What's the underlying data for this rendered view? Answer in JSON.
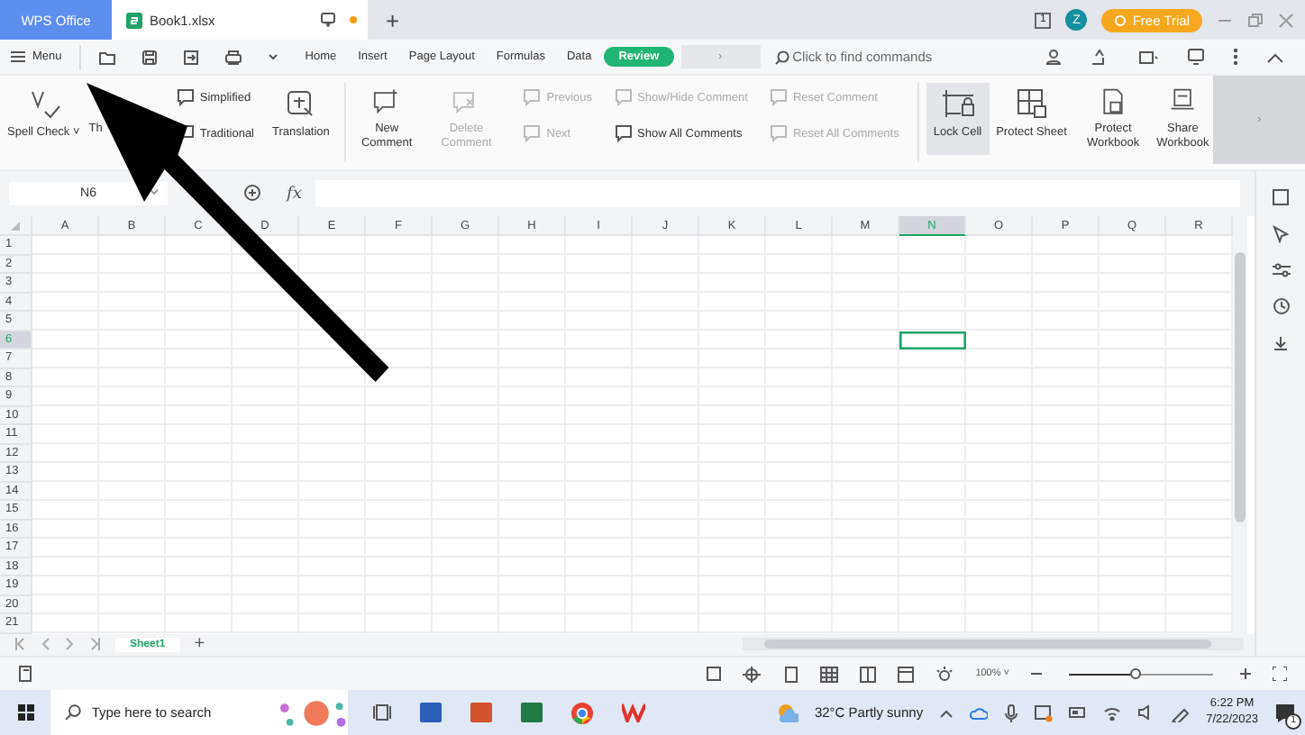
{
  "title_bar": {
    "tabs": [
      {
        "label": "WPS Office",
        "selected": false,
        "kind": "home"
      },
      {
        "label": "Book1.xlsx",
        "selected": true,
        "kind": "document"
      }
    ],
    "new_tab": "+",
    "badge_count": "1",
    "avatar": "Z",
    "trial_button": "Free Trial"
  },
  "menu_bar": {
    "menu": "Menu",
    "tabs": [
      {
        "label": "Home",
        "selected": false
      },
      {
        "label": "Insert",
        "selected": false
      },
      {
        "label": "Page Layout",
        "selected": false
      },
      {
        "label": "Formulas",
        "selected": false
      },
      {
        "label": "Data",
        "selected": false
      },
      {
        "label": "Review",
        "selected": true
      }
    ],
    "more": "›",
    "search": {
      "placeholder": "Click to find commands"
    }
  },
  "ribbon": {
    "items": [
      {
        "kind": "large",
        "label": "Spell Check ˅",
        "disabled": false,
        "on": false
      },
      {
        "kind": "cut",
        "label": "Th"
      },
      {
        "kind": "pair",
        "items": [
          {
            "label": "Simplified",
            "disabled": false
          },
          {
            "label": "Traditional",
            "disabled": false
          }
        ]
      },
      {
        "kind": "large",
        "label": "Translation",
        "disabled": false,
        "on": false
      },
      {
        "kind": "separator"
      },
      {
        "kind": "large",
        "label": "New Comment",
        "disabled": false,
        "on": false
      },
      {
        "kind": "large",
        "label": "Delete Comment",
        "disabled": true,
        "on": false
      },
      {
        "kind": "pair",
        "items": [
          {
            "label": "Previous",
            "disabled": true
          },
          {
            "label": "Next",
            "disabled": true
          }
        ]
      },
      {
        "kind": "pair",
        "items": [
          {
            "label": "Show/Hide Comment",
            "disabled": true
          },
          {
            "label": "Show All Comments",
            "disabled": false
          }
        ]
      },
      {
        "kind": "pair",
        "items": [
          {
            "label": "Reset Comment",
            "disabled": true
          },
          {
            "label": "Reset All Comments",
            "disabled": true
          }
        ]
      },
      {
        "kind": "separator"
      },
      {
        "kind": "large",
        "label": "Lock Cell",
        "disabled": false,
        "on": true
      },
      {
        "kind": "large",
        "label": "Protect Sheet",
        "disabled": false,
        "on": false
      },
      {
        "kind": "large",
        "label": "Protect Workbook",
        "disabled": false,
        "on": false
      },
      {
        "kind": "large",
        "label": "Share Workbook",
        "disabled": false,
        "on": false
      }
    ],
    "more": "›"
  },
  "formula_bar": {
    "name_box": "N6",
    "fx": "fx"
  },
  "sheet": {
    "columns": [
      {
        "label": "A",
        "selected": false
      },
      {
        "label": "B",
        "selected": false
      },
      {
        "label": "C",
        "selected": false
      },
      {
        "label": "D",
        "selected": false
      },
      {
        "label": "E",
        "selected": false
      },
      {
        "label": "F",
        "selected": false
      },
      {
        "label": "G",
        "selected": false
      },
      {
        "label": "H",
        "selected": false
      },
      {
        "label": "I",
        "selected": false
      },
      {
        "label": "J",
        "selected": false
      },
      {
        "label": "K",
        "selected": false
      },
      {
        "label": "L",
        "selected": false
      },
      {
        "label": "M",
        "selected": false
      },
      {
        "label": "N",
        "selected": true
      },
      {
        "label": "O",
        "selected": false
      },
      {
        "label": "P",
        "selected": false
      },
      {
        "label": "Q",
        "selected": false
      },
      {
        "label": "R",
        "selected": false
      }
    ],
    "rows": [
      {
        "label": "1",
        "selected": false
      },
      {
        "label": "2",
        "selected": false
      },
      {
        "label": "3",
        "selected": false
      },
      {
        "label": "4",
        "selected": false
      },
      {
        "label": "5",
        "selected": false
      },
      {
        "label": "6",
        "selected": true
      },
      {
        "label": "7",
        "selected": false
      },
      {
        "label": "8",
        "selected": false
      },
      {
        "label": "9",
        "selected": false
      },
      {
        "label": "10",
        "selected": false
      },
      {
        "label": "11",
        "selected": false
      },
      {
        "label": "12",
        "selected": false
      },
      {
        "label": "13",
        "selected": false
      },
      {
        "label": "14",
        "selected": false
      },
      {
        "label": "15",
        "selected": false
      },
      {
        "label": "16",
        "selected": false
      },
      {
        "label": "17",
        "selected": false
      },
      {
        "label": "18",
        "selected": false
      },
      {
        "label": "19",
        "selected": false
      },
      {
        "label": "20",
        "selected": false
      },
      {
        "label": "21",
        "selected": false
      }
    ]
  },
  "sheet_tabs": [
    {
      "label": "Sheet1",
      "selected": true
    }
  ],
  "add_sheet": "+",
  "status_bar": {
    "zoom": "100% ˅",
    "zoom_slider": {
      "level": 0.47
    }
  },
  "taskbar": {
    "search": {
      "placeholder": "Type here to search"
    },
    "weather": "32°C  Partly sunny",
    "time": "6:22 PM",
    "date": "7/22/2023",
    "notifications": "1"
  }
}
